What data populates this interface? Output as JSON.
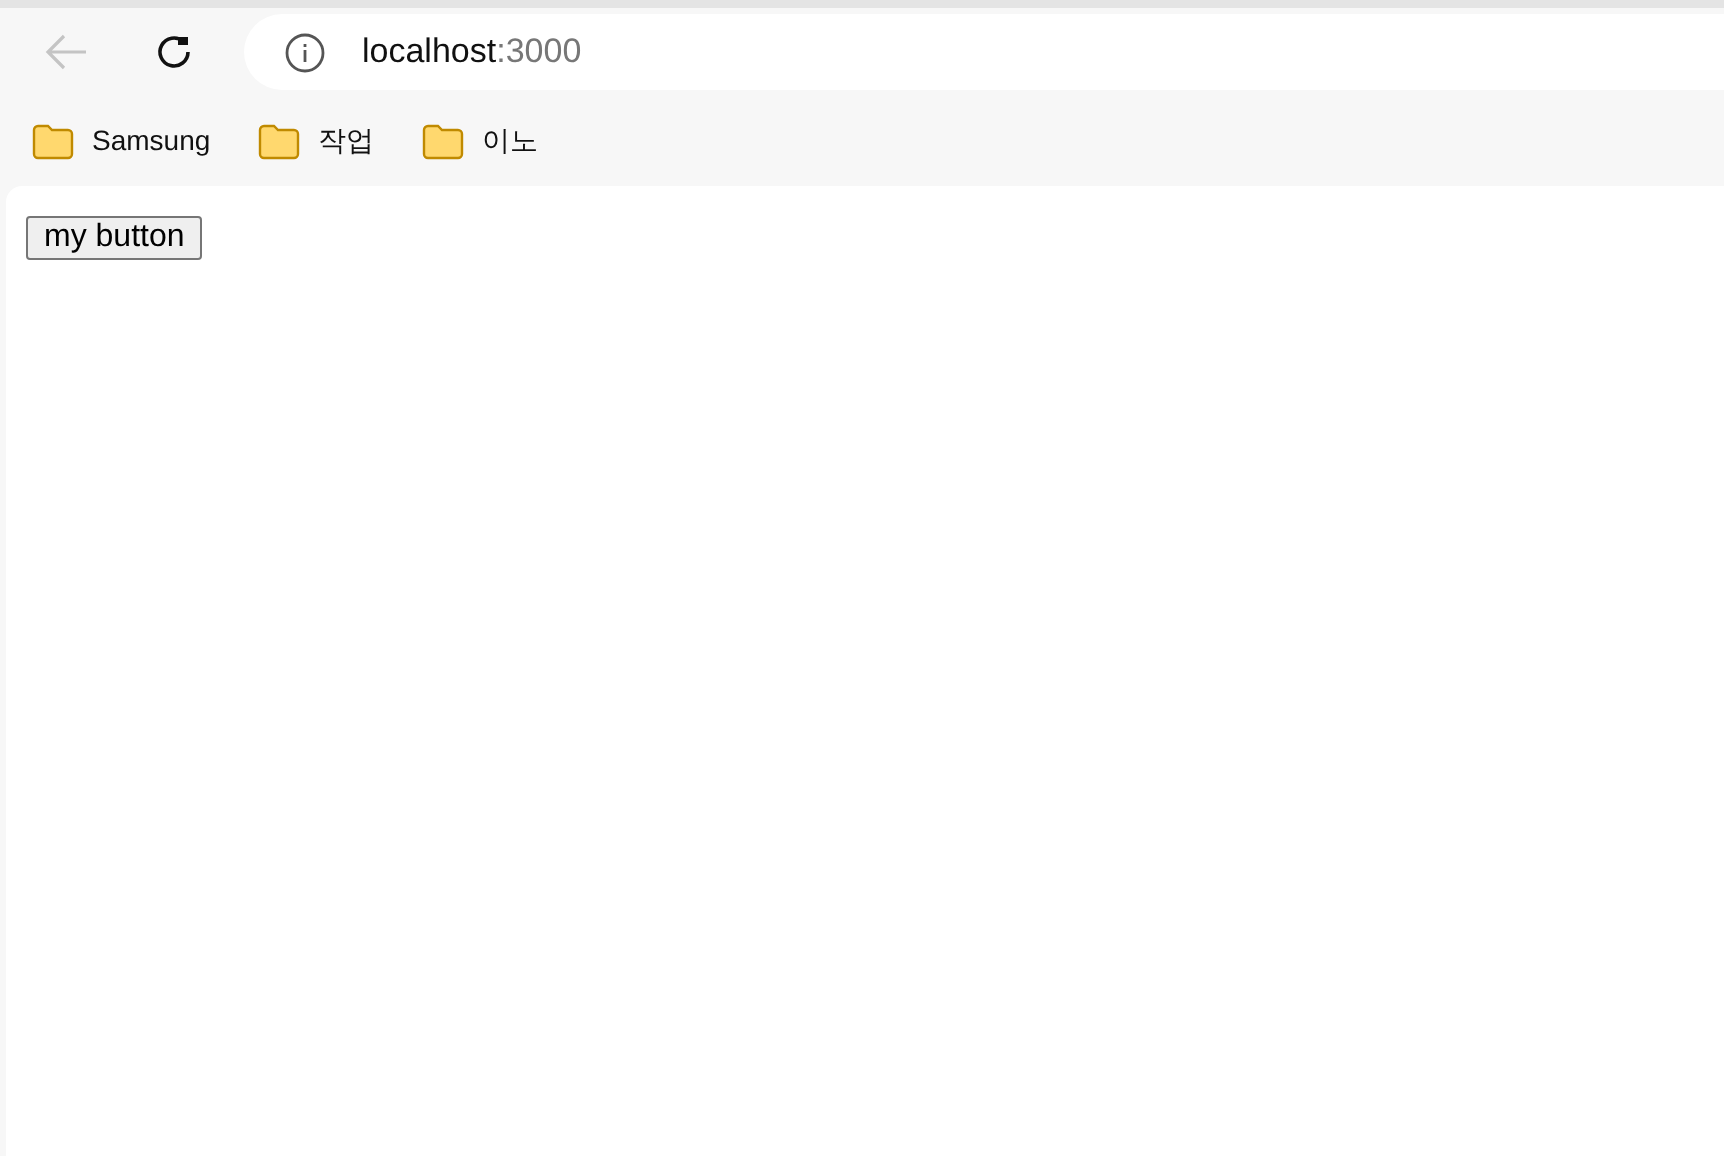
{
  "toolbar": {
    "back_disabled": true,
    "address": {
      "host": "localhost",
      "port": ":3000"
    }
  },
  "bookmarks": [
    {
      "label": "Samsung"
    },
    {
      "label": "작업"
    },
    {
      "label": "이노"
    }
  ],
  "page": {
    "button": "my button"
  }
}
